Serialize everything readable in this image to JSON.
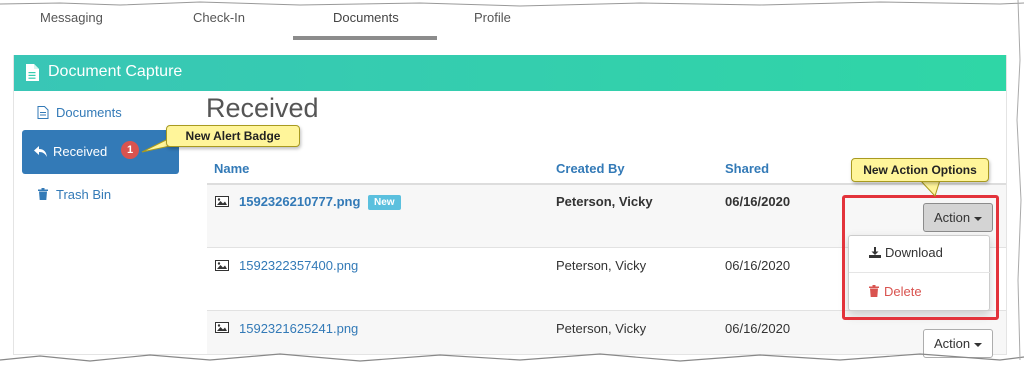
{
  "nav": {
    "tabs": [
      {
        "label": "Messaging"
      },
      {
        "label": "Check-In"
      },
      {
        "label": "Documents"
      },
      {
        "label": "Profile"
      }
    ],
    "active": "Documents"
  },
  "panel": {
    "title": "Document Capture",
    "icon": "document-icon",
    "header_color": "#36cdb0"
  },
  "sidebar": {
    "items": [
      {
        "label": "Documents",
        "icon": "document-icon"
      },
      {
        "label": "Received",
        "icon": "reply-icon",
        "badge": "1"
      },
      {
        "label": "Trash Bin",
        "icon": "trash-icon"
      }
    ],
    "active_color": "#337ab7"
  },
  "main": {
    "title": "Received",
    "columns": [
      "Name",
      "Created By",
      "Shared"
    ],
    "rows": [
      {
        "name": "1592326210777.png",
        "badge": "New",
        "created_by": "Peterson, Vicky",
        "shared": "06/16/2020",
        "bold": true
      },
      {
        "name": "1592322357400.png",
        "created_by": "Peterson, Vicky",
        "shared": "06/16/2020",
        "bold": false
      },
      {
        "name": "1592321625241.png",
        "created_by": "Peterson, Vicky",
        "shared": "06/16/2020",
        "bold": false
      }
    ],
    "action_label": "Action",
    "dropdown": {
      "download": "Download",
      "delete": "Delete"
    }
  },
  "callouts": {
    "alert_badge": "New Alert Badge",
    "action_options": "New Action Options"
  },
  "colors": {
    "link": "#337ab7",
    "danger": "#d9534f",
    "badge_new": "#5bc0de",
    "callout": "#fff59a",
    "highlight": "#e3333b"
  }
}
